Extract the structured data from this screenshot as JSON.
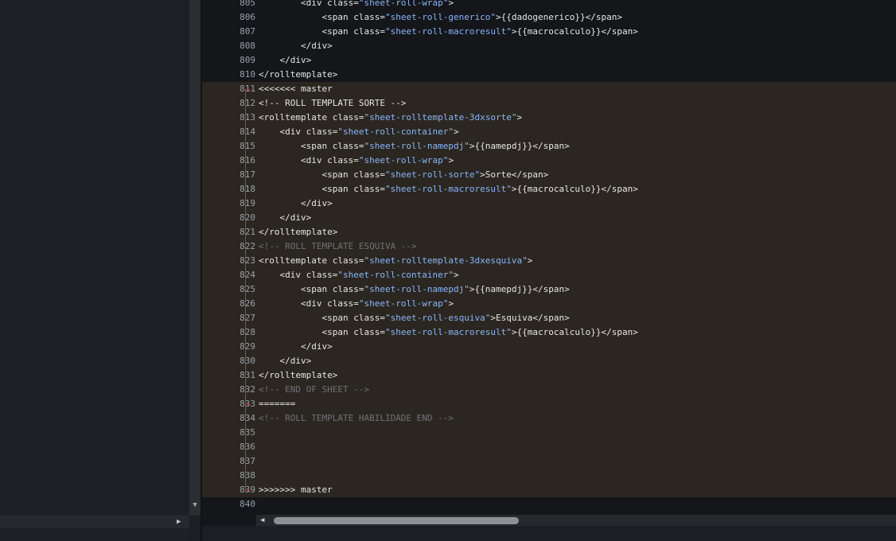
{
  "editor": {
    "lines": [
      {
        "n": "805",
        "hl": false,
        "parts": [
          [
            "",
            "        <div class="
          ],
          [
            "str",
            "\"sheet-roll-wrap\""
          ],
          [
            "",
            ">"
          ]
        ]
      },
      {
        "n": "806",
        "hl": false,
        "parts": [
          [
            "",
            "            <span class="
          ],
          [
            "str",
            "\"sheet-roll-generico\""
          ],
          [
            "",
            ">{{dadogenerico}}</span>"
          ]
        ]
      },
      {
        "n": "807",
        "hl": false,
        "parts": [
          [
            "",
            "            <span class="
          ],
          [
            "str",
            "\"sheet-roll-macroresult\""
          ],
          [
            "",
            ">{{macrocalculo}}</span>"
          ]
        ]
      },
      {
        "n": "808",
        "hl": false,
        "parts": [
          [
            "",
            "        </div>"
          ]
        ]
      },
      {
        "n": "809",
        "hl": false,
        "parts": [
          [
            "",
            "    </div>"
          ]
        ]
      },
      {
        "n": "810",
        "hl": false,
        "parts": [
          [
            "",
            "</rolltemplate>"
          ]
        ]
      },
      {
        "n": "811",
        "hl": true,
        "parts": [
          [
            "",
            "<<<<<<< master"
          ]
        ]
      },
      {
        "n": "812",
        "hl": true,
        "parts": [
          [
            "",
            "<!-- ROLL TEMPLATE SORTE -->"
          ]
        ]
      },
      {
        "n": "813",
        "hl": true,
        "parts": [
          [
            "",
            "<rolltemplate class="
          ],
          [
            "str",
            "\"sheet-rolltemplate-3dxsorte\""
          ],
          [
            "",
            ">"
          ]
        ]
      },
      {
        "n": "814",
        "hl": true,
        "parts": [
          [
            "",
            "    <div class="
          ],
          [
            "str",
            "\"sheet-roll-container\""
          ],
          [
            "",
            ">"
          ]
        ]
      },
      {
        "n": "815",
        "hl": true,
        "parts": [
          [
            "",
            "        <span class="
          ],
          [
            "str",
            "\"sheet-roll-namepdj\""
          ],
          [
            "",
            ">{{namepdj}}</span>"
          ]
        ]
      },
      {
        "n": "816",
        "hl": true,
        "parts": [
          [
            "",
            "        <div class="
          ],
          [
            "str",
            "\"sheet-roll-wrap\""
          ],
          [
            "",
            ">"
          ]
        ]
      },
      {
        "n": "817",
        "hl": true,
        "parts": [
          [
            "",
            "            <span class="
          ],
          [
            "str",
            "\"sheet-roll-sorte\""
          ],
          [
            "",
            ">Sorte</span>"
          ]
        ]
      },
      {
        "n": "818",
        "hl": true,
        "parts": [
          [
            "",
            "            <span class="
          ],
          [
            "str",
            "\"sheet-roll-macroresult\""
          ],
          [
            "",
            ">{{macrocalculo}}</span>"
          ]
        ]
      },
      {
        "n": "819",
        "hl": true,
        "parts": [
          [
            "",
            "        </div>"
          ]
        ]
      },
      {
        "n": "820",
        "hl": true,
        "parts": [
          [
            "",
            "    </div>"
          ]
        ]
      },
      {
        "n": "821",
        "hl": true,
        "parts": [
          [
            "",
            "</rolltemplate>"
          ]
        ]
      },
      {
        "n": "822",
        "hl": true,
        "parts": [
          [
            "cmt",
            "<!-- ROLL TEMPLATE ESQUIVA -->"
          ]
        ]
      },
      {
        "n": "823",
        "hl": true,
        "parts": [
          [
            "",
            "<rolltemplate class="
          ],
          [
            "str",
            "\"sheet-rolltemplate-3dxesquiva\""
          ],
          [
            "",
            ">"
          ]
        ]
      },
      {
        "n": "824",
        "hl": true,
        "parts": [
          [
            "",
            "    <div class="
          ],
          [
            "str",
            "\"sheet-roll-container\""
          ],
          [
            "",
            ">"
          ]
        ]
      },
      {
        "n": "825",
        "hl": true,
        "parts": [
          [
            "",
            "        <span class="
          ],
          [
            "str",
            "\"sheet-roll-namepdj\""
          ],
          [
            "",
            ">{{namepdj}}</span>"
          ]
        ]
      },
      {
        "n": "826",
        "hl": true,
        "parts": [
          [
            "",
            "        <div class="
          ],
          [
            "str",
            "\"sheet-roll-wrap\""
          ],
          [
            "",
            ">"
          ]
        ]
      },
      {
        "n": "827",
        "hl": true,
        "parts": [
          [
            "",
            "            <span class="
          ],
          [
            "str",
            "\"sheet-roll-esquiva\""
          ],
          [
            "",
            ">Esquiva</span>"
          ]
        ]
      },
      {
        "n": "828",
        "hl": true,
        "parts": [
          [
            "",
            "            <span class="
          ],
          [
            "str",
            "\"sheet-roll-macroresult\""
          ],
          [
            "",
            ">{{macrocalculo}}</span>"
          ]
        ]
      },
      {
        "n": "829",
        "hl": true,
        "parts": [
          [
            "",
            "        </div>"
          ]
        ]
      },
      {
        "n": "830",
        "hl": true,
        "parts": [
          [
            "",
            "    </div>"
          ]
        ]
      },
      {
        "n": "831",
        "hl": true,
        "parts": [
          [
            "",
            "</rolltemplate>"
          ]
        ]
      },
      {
        "n": "832",
        "hl": true,
        "parts": [
          [
            "cmt",
            "<!-- END OF SHEET -->"
          ]
        ]
      },
      {
        "n": "833",
        "hl": true,
        "parts": [
          [
            "",
            "======="
          ]
        ]
      },
      {
        "n": "834",
        "hl": true,
        "parts": [
          [
            "cmt",
            "<!-- ROLL TEMPLATE HABILIDADE END -->"
          ]
        ]
      },
      {
        "n": "835",
        "hl": true,
        "parts": []
      },
      {
        "n": "836",
        "hl": true,
        "parts": []
      },
      {
        "n": "837",
        "hl": true,
        "parts": []
      },
      {
        "n": "838",
        "hl": true,
        "parts": []
      },
      {
        "n": "839",
        "hl": true,
        "parts": [
          [
            "",
            ">>>>>>> master"
          ]
        ]
      },
      {
        "n": "840",
        "hl": false,
        "parts": []
      }
    ]
  },
  "icons": {
    "left_scroll_down": "chevron-down-icon",
    "left_scroll_right": "chevron-right-icon",
    "bottom_scroll_left": "chevron-left-icon"
  },
  "colors": {
    "string": "#8ab4f8",
    "comment": "#6d7278",
    "conflict_marker": "#c0392b",
    "conflict_highlight": "#2b2720"
  }
}
